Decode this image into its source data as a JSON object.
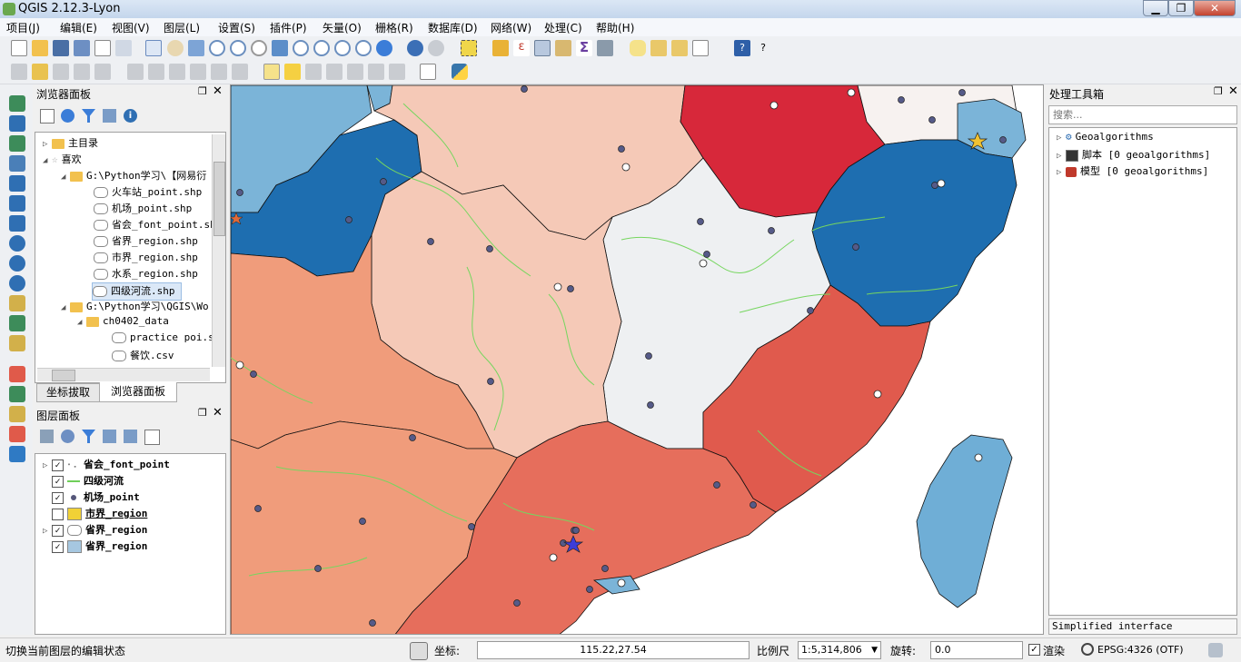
{
  "window": {
    "title": "QGIS 2.12.3-Lyon",
    "min": "▁",
    "max": "❐",
    "close": "✕"
  },
  "menu": [
    "项目(J)",
    "编辑(E)",
    "视图(V)",
    "图层(L)",
    "设置(S)",
    "插件(P)",
    "矢量(O)",
    "栅格(R)",
    "数据库(D)",
    "网络(W)",
    "处理(C)",
    "帮助(H)"
  ],
  "browser": {
    "title": "浏览器面板",
    "items": [
      "主目录",
      "喜欢",
      "G:\\Python学习\\【网易衍",
      "火车站_point.shp",
      "机场_point.shp",
      "省会_font_point.sh",
      "省界_region.shp",
      "市界_region.shp",
      "水系_region.shp",
      "四级河流.shp",
      "G:\\Python学习\\QGIS\\Wo",
      "ch0402_data",
      "practice poi.sl",
      "餐饮.csv"
    ],
    "tabs": [
      "坐标拔取",
      "浏览器面板"
    ]
  },
  "layers": {
    "title": "图层面板",
    "items": [
      {
        "name": "省会_font_point",
        "checked": true
      },
      {
        "name": "四级河流",
        "checked": true
      },
      {
        "name": "机场_point",
        "checked": true
      },
      {
        "name": "市界_region",
        "checked": false
      },
      {
        "name": "省界_region",
        "checked": true
      },
      {
        "name": "省界_region",
        "checked": true
      }
    ]
  },
  "toolbox": {
    "title": "处理工具箱",
    "search_placeholder": "搜索...",
    "items": [
      "Geoalgorithms",
      "脚本 [0 geoalgorithms]",
      "模型 [0 geoalgorithms]"
    ],
    "interface": "Simplified interface"
  },
  "status": {
    "message": "切换当前图层的编辑状态",
    "coord_label": "坐标:",
    "coord_value": "115.22,27.54",
    "scale_label": "比例尺",
    "scale_value": "1:5,314,806",
    "rotation_label": "旋转:",
    "rotation_value": "0.0",
    "render_label": "渲染",
    "crs": "EPSG:4326 (OTF)"
  },
  "colors": {
    "dark_blue": "#1e6eb0",
    "light_blue": "#7bb4d8",
    "red": "#d7283a",
    "salmon": "#f09c7b",
    "peach": "#f5c9b7",
    "light_grey": "#eef0f2",
    "coral": "#e66e5c"
  }
}
